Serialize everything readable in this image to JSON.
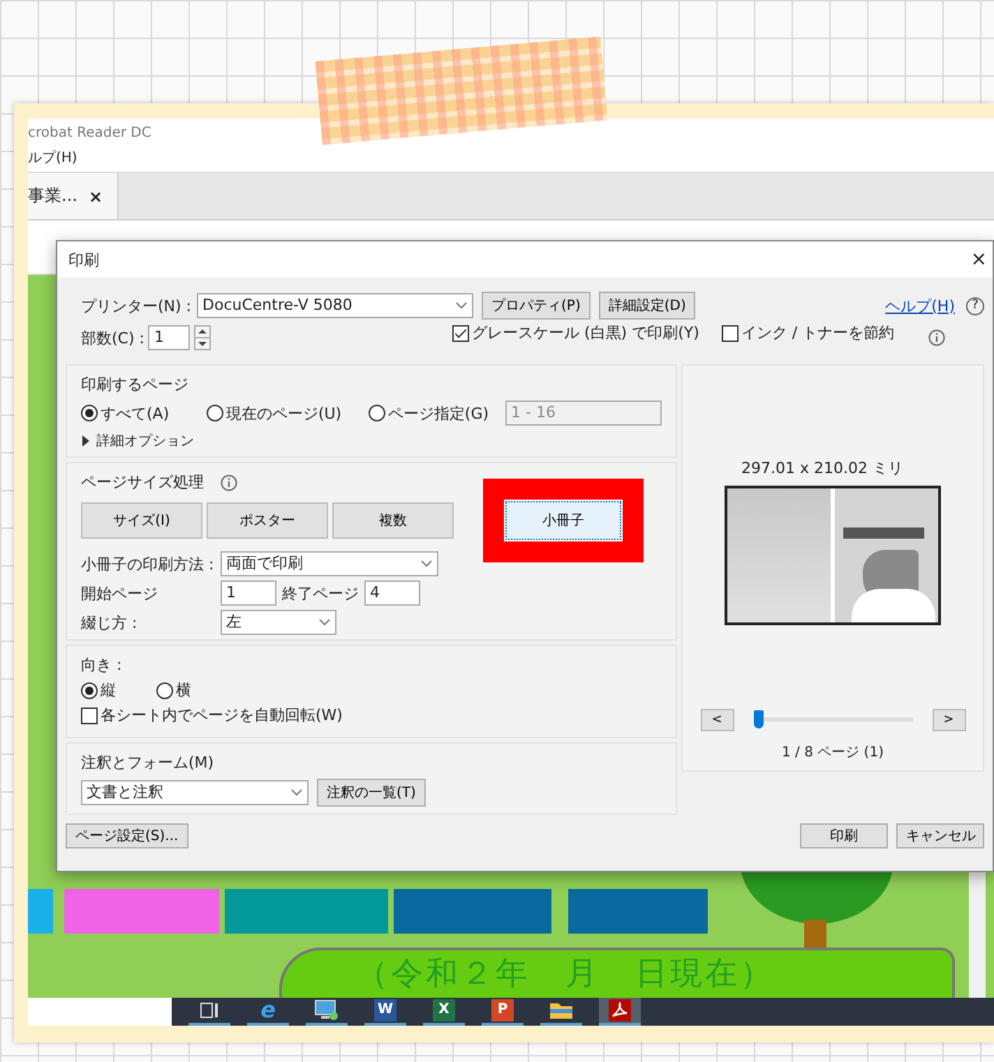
{
  "app": {
    "title": "crobat Reader DC",
    "menu": [
      "ルプ(H)"
    ],
    "tabs": [
      {
        "label": "事業...",
        "close": "×",
        "selected": true
      }
    ]
  },
  "document": {
    "caption": "（令和２年　月　日現在）"
  },
  "dialog": {
    "title": "印刷",
    "close": "×",
    "printer": {
      "label": "プリンター(N) :",
      "value": "DocuCentre-V 5080"
    },
    "top_buttons": [
      "プロパティ(P)",
      "詳細設定(D)"
    ],
    "help": "ヘルプ(H)",
    "help_icon": "?",
    "copies": {
      "label": "部数(C) :",
      "value": "1"
    },
    "options": [
      {
        "label": "グレースケール (白黒) で印刷(Y)",
        "checked": true
      },
      {
        "label": "インク / トナーを節約",
        "checked": false
      }
    ],
    "pages": {
      "title": "印刷するページ",
      "radios": [
        {
          "label": "すべて(A)",
          "selected": true
        },
        {
          "label": "現在のページ(U)",
          "selected": false
        },
        {
          "label": "ページ指定(G)",
          "selected": false
        }
      ],
      "range": {
        "value": "1 - 16",
        "disabled": true
      },
      "more": "詳細オプション"
    },
    "sizing": {
      "title": "ページサイズ処理",
      "modes": [
        {
          "label": "サイズ(I)",
          "selected": false,
          "highlighted": false
        },
        {
          "label": "ポスター",
          "selected": false,
          "highlighted": false
        },
        {
          "label": "複数",
          "selected": false,
          "highlighted": false
        },
        {
          "label": "小冊子",
          "selected": true,
          "highlighted": true
        }
      ],
      "method": {
        "label": "小冊子の印刷方法 :",
        "value": "両面で印刷"
      },
      "start": {
        "label": "開始ページ",
        "value": "1"
      },
      "end": {
        "label": "終了ページ",
        "value": "4"
      },
      "binding": {
        "label": "綴じ方 :",
        "value": "左"
      }
    },
    "orientation": {
      "title": "向き :",
      "radios": [
        {
          "label": "縦",
          "selected": true
        },
        {
          "label": "横",
          "selected": false
        }
      ],
      "auto_rotate": {
        "label": "各シート内でページを自動回転(W)",
        "checked": false
      }
    },
    "comments": {
      "title": "注釈とフォーム(M)",
      "value": "文書と注釈",
      "button": "注釈の一覧(T)"
    },
    "preview": {
      "size": "297.01 x 210.02 ミリ",
      "prev": "<",
      "next": ">",
      "level": 0,
      "page": "1 / 8 ページ (1)"
    },
    "footer": {
      "setup": "ページ設定(S)...",
      "print": "印刷",
      "cancel": "キャンセル"
    }
  },
  "taskbar": {
    "apps": [
      {
        "kind": "taskview",
        "selected": false
      },
      {
        "kind": "browser",
        "glyph": "e",
        "selected": false
      },
      {
        "kind": "network",
        "selected": false
      },
      {
        "kind": "doc",
        "glyph": "W",
        "selected": false
      },
      {
        "kind": "sheet",
        "glyph": "X",
        "selected": false
      },
      {
        "kind": "slides",
        "glyph": "P",
        "selected": false
      },
      {
        "kind": "folder",
        "selected": false
      },
      {
        "kind": "pdf",
        "selected": true
      }
    ]
  }
}
